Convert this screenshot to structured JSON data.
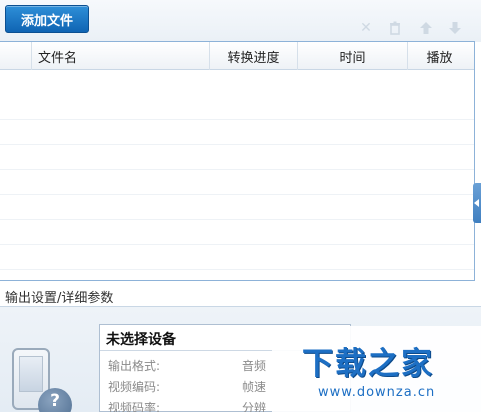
{
  "toolbar": {
    "add_file_label": "添加文件",
    "icons": {
      "delete": "✕",
      "trash": "🗑",
      "move_up": "⬆",
      "move_down": "⬇"
    }
  },
  "file_list": {
    "columns": [
      "文件名",
      "转换进度",
      "时间",
      "播放"
    ],
    "rows": []
  },
  "settings": {
    "section_label": "输出设置/详细参数",
    "device_title": "未选择设备",
    "params": [
      {
        "label": "输出格式:",
        "value": "音频"
      },
      {
        "label": "视频编码:",
        "value": "帧速"
      },
      {
        "label": "视频码率:",
        "value": "分辨"
      }
    ]
  },
  "watermark": {
    "logo_text": "下载之家",
    "url": "www.downza.cn"
  },
  "colors": {
    "accent": "#1573c6",
    "border": "#8db2d8",
    "watermark": "#1d6fc4"
  }
}
